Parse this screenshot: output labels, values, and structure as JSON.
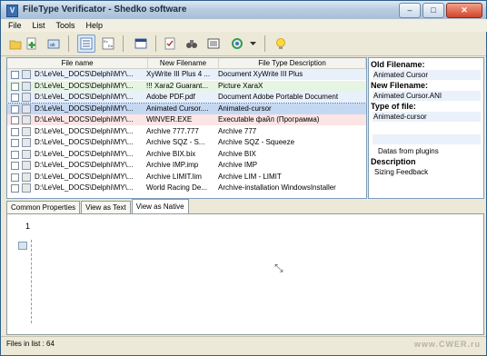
{
  "window": {
    "title": "FileType Verificator - Shedko software",
    "app_icon_glyph": "V",
    "controls": {
      "minimize": "–",
      "maximize": "□",
      "close": "✕"
    }
  },
  "menu": [
    "File",
    "List",
    "Tools",
    "Help"
  ],
  "toolbar": {
    "icons": [
      "open-folder-icon",
      "add-icon",
      "list-view-icon",
      "columns-view-icon",
      "details-view-icon",
      "window-view-icon",
      "checklist-icon",
      "binoculars-icon",
      "properties-icon",
      "refresh-icon",
      "dropdown-arrow-icon",
      "lightbulb-icon"
    ]
  },
  "list": {
    "headers": [
      "File name",
      "New Filename",
      "File Type Description"
    ],
    "rows": [
      {
        "file": "D:\\LeVeL_DOCS\\Delphi\\MY\\...",
        "new": "XyWrite III Plus 4 ...",
        "desc": "Document XyWrite III Plus",
        "highlight": "#e8f0fb"
      },
      {
        "file": "D:\\LeVeL_DOCS\\Delphi\\MY\\...",
        "new": "!!! Xara2 Guarant...",
        "desc": "Picture XaraX",
        "highlight": "#e6f5e3"
      },
      {
        "file": "D:\\LeVeL_DOCS\\Delphi\\MY\\...",
        "new": "Adobe PDF.pdf",
        "desc": "Document Adobe Portable Document",
        "highlight": "#e8f0fb"
      },
      {
        "file": "D:\\LeVeL_DOCS\\Delphi\\MY\\...",
        "new": "Animated Cursor....",
        "desc": "Animated-cursor",
        "highlight": "#c5d8f2",
        "selected": true
      },
      {
        "file": "D:\\LeVeL_DOCS\\Delphi\\MY\\...",
        "new": "WINVER.EXE",
        "desc": "Executable файл (Программа)",
        "highlight": "#fbe5e5"
      },
      {
        "file": "D:\\LeVeL_DOCS\\Delphi\\MY\\...",
        "new": "Archive 777.777",
        "desc": "Archive 777",
        "highlight": "#ffffff"
      },
      {
        "file": "D:\\LeVeL_DOCS\\Delphi\\MY\\...",
        "new": "Archive  SQZ - S...",
        "desc": "Archive SQZ - Squeeze",
        "highlight": "#ffffff"
      },
      {
        "file": "D:\\LeVeL_DOCS\\Delphi\\MY\\...",
        "new": "Archive BIX.bix",
        "desc": "Archive BIX",
        "highlight": "#ffffff"
      },
      {
        "file": "D:\\LeVeL_DOCS\\Delphi\\MY\\...",
        "new": "Archive IMP.imp",
        "desc": "Archive IMP",
        "highlight": "#ffffff"
      },
      {
        "file": "D:\\LeVeL_DOCS\\Delphi\\MY\\...",
        "new": "Archive LIMIT.lim",
        "desc": "Archive LIM - LIMIT",
        "highlight": "#ffffff"
      },
      {
        "file": "D:\\LeVeL_DOCS\\Delphi\\MY\\...",
        "new": "World Racing De...",
        "desc": "Archive-installation WindowsInstaller",
        "highlight": "#ffffff"
      }
    ]
  },
  "details": {
    "old_label": "Old Filename:",
    "old_value": "Animated Cursor",
    "new_label": "New Filename:",
    "new_value": "Animated Cursor.ANI",
    "type_label": "Type of file:",
    "type_value": "Animated-cursor",
    "plugins_text": "Datas from plugins",
    "desc_label": "Description",
    "desc_value": "Sizing Feedback"
  },
  "tabs": [
    "Common Properties",
    "View as Text",
    "View as Native"
  ],
  "native": {
    "frame_number": "1"
  },
  "status": {
    "files_in_list": "Files in list : 64"
  },
  "watermark": "www.CWER.ru"
}
